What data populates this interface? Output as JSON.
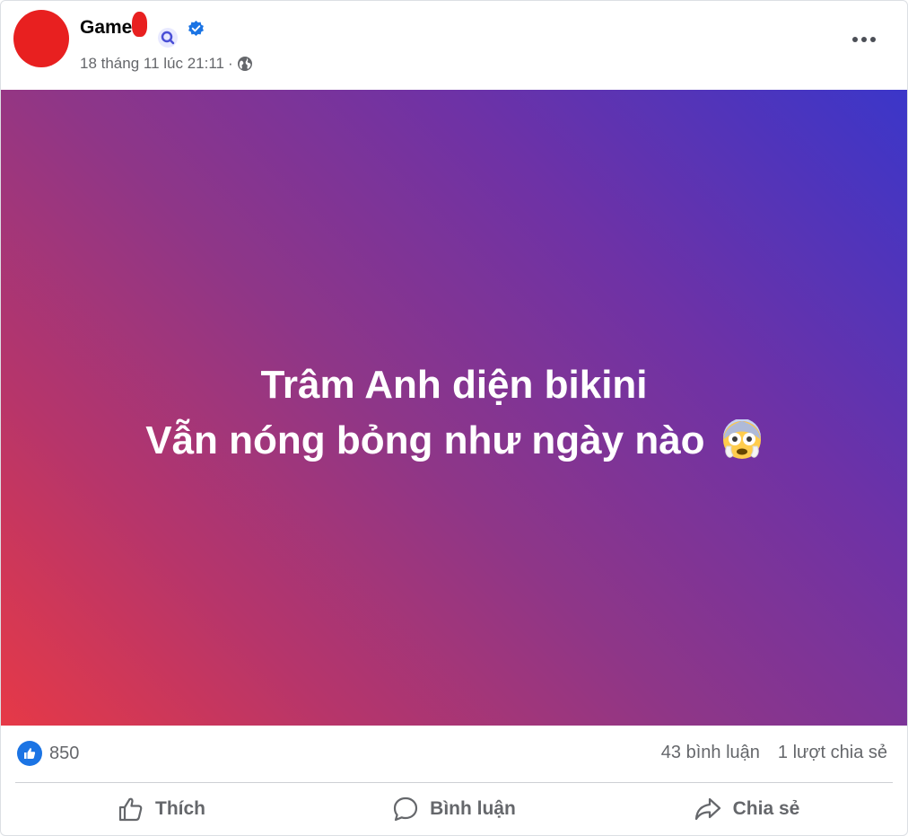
{
  "post": {
    "author": "Game",
    "timestamp": "18 tháng 11 lúc 21:11",
    "separator": "·",
    "privacy_icon": "globe-icon",
    "badges": [
      "search-badge-icon",
      "verified-badge-icon"
    ]
  },
  "content": {
    "line1": "Trâm Anh diện bikini",
    "line2": "Vẫn nóng bỏng như ngày nào",
    "emoji": "flushed-face-emoji",
    "gradient": [
      "#3b36c9",
      "#8e3688",
      "#e63947"
    ]
  },
  "stats": {
    "likes": "850",
    "comments": "43 bình luận",
    "shares": "1 lượt chia sẻ"
  },
  "actions": {
    "like": "Thích",
    "comment": "Bình luận",
    "share": "Chia sẻ"
  },
  "colors": {
    "accent": "#1b74e4",
    "muted_text": "#65676b",
    "redaction": "#e82020"
  }
}
